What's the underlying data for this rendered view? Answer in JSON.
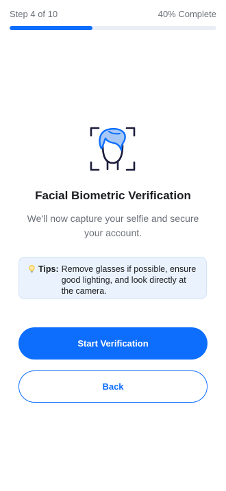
{
  "progress": {
    "step_label": "Step 4 of 10",
    "percent_label": "40% Complete",
    "percent": 40
  },
  "icons": {
    "face": "face-scan-icon",
    "tip": "lightbulb-icon"
  },
  "main": {
    "title": "Facial Biometric Verification",
    "subtitle": "We'll now capture your selfie and secure your account."
  },
  "tips": {
    "label": "Tips:",
    "text": "Remove glasses if possible, ensure good lighting, and look directly at the camera."
  },
  "actions": {
    "start_label": "Start Verification",
    "back_label": "Back"
  },
  "colors": {
    "accent": "#0d6efd",
    "progress_track": "#eaeff7",
    "tips_background": "#eaf2fd",
    "title_text": "#1c1d21",
    "muted_text": "#6b6f78"
  }
}
